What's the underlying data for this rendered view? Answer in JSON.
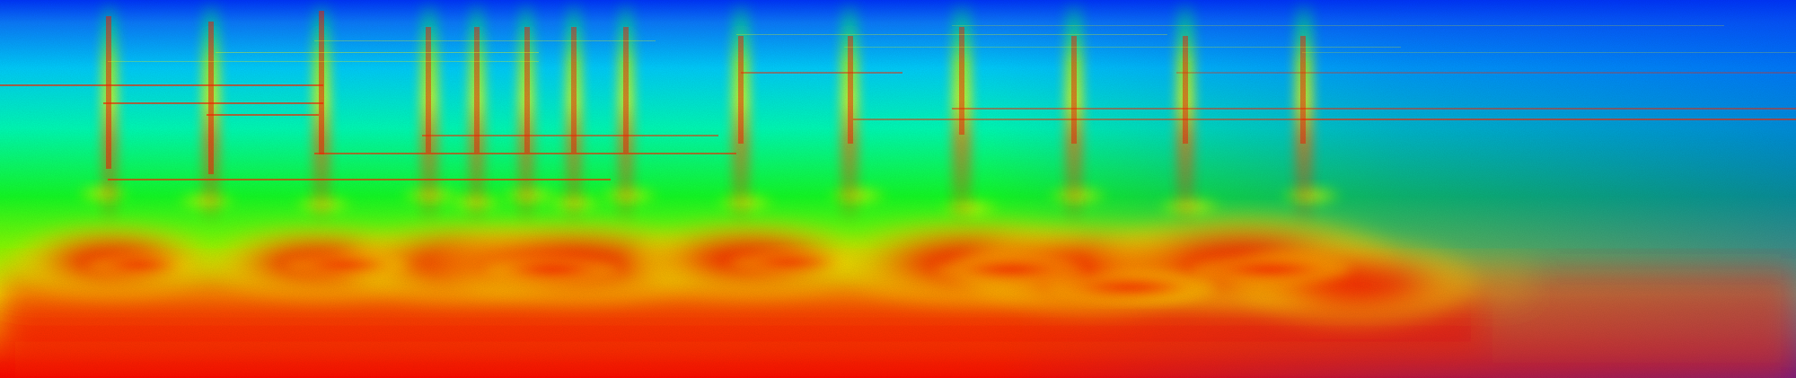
{
  "image": {
    "kind": "spectrogram",
    "colormap": [
      "#0033ff",
      "#00b4ff",
      "#00ffb3",
      "#00ff00",
      "#b6ff00",
      "#ffff00",
      "#ff8c00",
      "#ff0000"
    ],
    "text": []
  }
}
